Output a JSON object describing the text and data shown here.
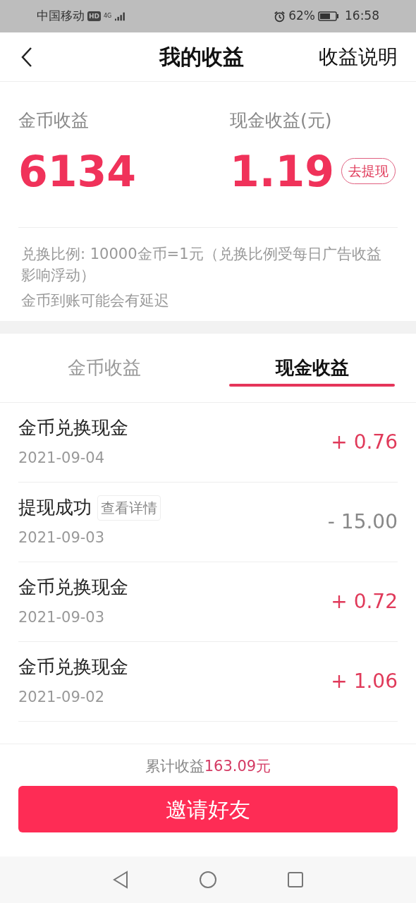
{
  "status_bar": {
    "carrier": "中国移动",
    "hd": "HD",
    "network": "4G",
    "battery": "62%",
    "time": "16:58"
  },
  "header": {
    "title": "我的收益",
    "action": "收益说明"
  },
  "summary": {
    "coins": {
      "label": "金币收益",
      "value": "6134"
    },
    "cash": {
      "label": "现金收益(元)",
      "value": "1.19",
      "button": "去提现"
    },
    "notes": [
      "兑换比例: 10000金币=1元（兑换比例受每日广告收益影响浮动）",
      "金币到账可能会有延迟"
    ]
  },
  "tabs": [
    {
      "label": "金币收益",
      "selected": false
    },
    {
      "label": "现金收益",
      "selected": true
    }
  ],
  "records": [
    {
      "title": "金币兑换现金",
      "date": "2021-09-04",
      "amount": "+ 0.76",
      "kind": "credit"
    },
    {
      "title": "提现成功",
      "tag": "查看详情",
      "date": "2021-09-03",
      "amount": "- 15.00",
      "kind": "debit"
    },
    {
      "title": "金币兑换现金",
      "date": "2021-09-03",
      "amount": "+ 0.72",
      "kind": "credit"
    },
    {
      "title": "金币兑换现金",
      "date": "2021-09-02",
      "amount": "+ 1.06",
      "kind": "credit"
    }
  ],
  "total": {
    "label": "累计收益",
    "value": "163.09元"
  },
  "invite_button": "邀请好友"
}
